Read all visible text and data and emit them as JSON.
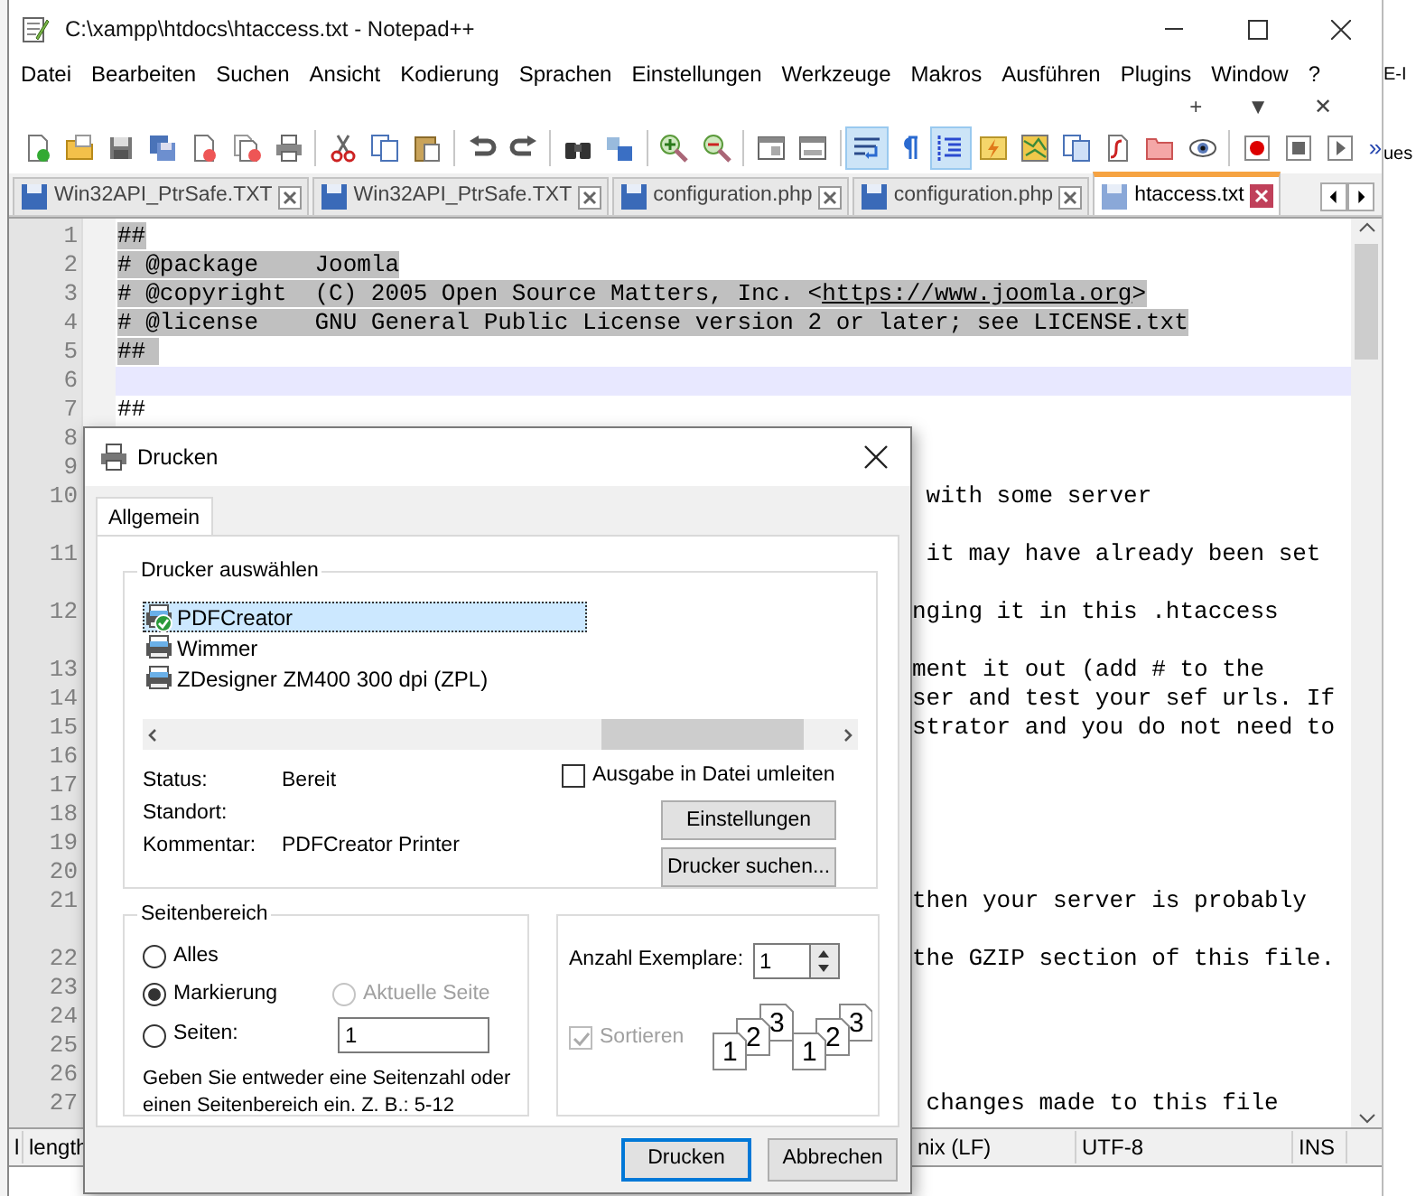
{
  "window": {
    "title": "C:\\xampp\\htdocs\\htaccess.txt - Notepad++"
  },
  "menu": [
    "Datei",
    "Bearbeiten",
    "Suchen",
    "Ansicht",
    "Kodierung",
    "Sprachen",
    "Einstellungen",
    "Werkzeuge",
    "Makros",
    "Ausführen",
    "Plugins",
    "Window",
    "?"
  ],
  "mdi_controls": [
    "+",
    "▼",
    "✕"
  ],
  "toolbar": [
    {
      "kind": "button",
      "pressed": false
    },
    {
      "kind": "button",
      "pressed": false
    },
    {
      "kind": "button",
      "pressed": false
    },
    {
      "kind": "button",
      "pressed": false
    },
    {
      "kind": "button",
      "pressed": false
    },
    {
      "kind": "button",
      "pressed": false
    },
    {
      "kind": "button",
      "pressed": false
    },
    {
      "kind": "separator"
    },
    {
      "kind": "button",
      "pressed": false
    },
    {
      "kind": "button",
      "pressed": false
    },
    {
      "kind": "button",
      "pressed": false
    },
    {
      "kind": "separator"
    },
    {
      "kind": "button",
      "pressed": false
    },
    {
      "kind": "button",
      "pressed": false
    },
    {
      "kind": "separator"
    },
    {
      "kind": "button",
      "pressed": false
    },
    {
      "kind": "button",
      "pressed": false
    },
    {
      "kind": "separator"
    },
    {
      "kind": "button",
      "pressed": false
    },
    {
      "kind": "button",
      "pressed": false
    },
    {
      "kind": "separator"
    },
    {
      "kind": "button",
      "pressed": false
    },
    {
      "kind": "button",
      "pressed": false
    },
    {
      "kind": "separator"
    },
    {
      "kind": "button",
      "pressed": true
    },
    {
      "kind": "button",
      "pressed": false
    },
    {
      "kind": "button",
      "pressed": true
    },
    {
      "kind": "button",
      "pressed": false
    },
    {
      "kind": "button",
      "pressed": false
    },
    {
      "kind": "button",
      "pressed": false
    },
    {
      "kind": "button",
      "pressed": false
    },
    {
      "kind": "button",
      "pressed": false
    },
    {
      "kind": "button",
      "pressed": false
    },
    {
      "kind": "separator"
    },
    {
      "kind": "button",
      "pressed": false
    },
    {
      "kind": "button",
      "pressed": false
    },
    {
      "kind": "button",
      "pressed": false
    }
  ],
  "toolbar_overflow": "»",
  "tabs": [
    {
      "label": "Win32API_PtrSafe.TXT",
      "selected": false
    },
    {
      "label": "Win32API_PtrSafe.TXT",
      "selected": false
    },
    {
      "label": "configuration.php",
      "selected": false
    },
    {
      "label": "configuration.php",
      "selected": false
    },
    {
      "label": "htaccess.txt",
      "selected": true
    }
  ],
  "editor": {
    "lines": [
      {
        "kind": "line",
        "number": "1",
        "selected": true,
        "segments": [
          {
            "kind": "code",
            "text": "##"
          }
        ]
      },
      {
        "kind": "line",
        "number": "2",
        "selected": true,
        "segments": [
          {
            "kind": "code",
            "text": "# @package    Joomla"
          }
        ]
      },
      {
        "kind": "line",
        "number": "3",
        "selected": true,
        "segments": [
          {
            "kind": "code",
            "text": "# @copyright  (C) 2005 Open Source Matters, Inc. <"
          },
          {
            "kind": "link",
            "text": "https://www.joomla.org"
          },
          {
            "kind": "code",
            "text": ">"
          }
        ]
      },
      {
        "kind": "line",
        "number": "4",
        "selected": true,
        "segments": [
          {
            "kind": "code",
            "text": "# @license    GNU General Public License version 2 or later; see LICENSE.txt"
          }
        ]
      },
      {
        "kind": "line",
        "number": "5",
        "selected": true,
        "segments": [
          {
            "kind": "code",
            "text": "## "
          }
        ]
      },
      {
        "kind": "line",
        "number": "6",
        "current": true
      },
      {
        "kind": "line",
        "number": "7",
        "segments": [
          {
            "kind": "code",
            "text": "##"
          }
        ]
      },
      {
        "kind": "line",
        "number": "8"
      },
      {
        "kind": "line",
        "number": "9"
      },
      {
        "kind": "line",
        "number": "10",
        "clipped": true,
        "segments": [
          {
            "kind": "code",
            "text": " with some server"
          }
        ]
      },
      {
        "kind": "wrap"
      },
      {
        "kind": "line",
        "number": "11",
        "clipped": true,
        "segments": [
          {
            "kind": "code",
            "text": " it may have already been set"
          }
        ]
      },
      {
        "kind": "wrap"
      },
      {
        "kind": "line",
        "number": "12",
        "clipped": true,
        "segments": [
          {
            "kind": "code",
            "text": "nging it in this .htaccess"
          }
        ]
      },
      {
        "kind": "wrap"
      },
      {
        "kind": "line",
        "number": "13",
        "clipped": true,
        "segments": [
          {
            "kind": "code",
            "text": "ment it out (add # to the"
          }
        ]
      },
      {
        "kind": "line",
        "number": "14",
        "clipped": true,
        "segments": [
          {
            "kind": "code",
            "text": "ser and test your sef urls. If"
          }
        ]
      },
      {
        "kind": "line",
        "number": "15",
        "clipped": true,
        "segments": [
          {
            "kind": "code",
            "text": "strator and you do not need to"
          }
        ]
      },
      {
        "kind": "line",
        "number": "16"
      },
      {
        "kind": "line",
        "number": "17"
      },
      {
        "kind": "line",
        "number": "18"
      },
      {
        "kind": "line",
        "number": "19"
      },
      {
        "kind": "line",
        "number": "20"
      },
      {
        "kind": "line",
        "number": "21",
        "clipped": true,
        "segments": [
          {
            "kind": "code",
            "text": "then your server is probably"
          }
        ]
      },
      {
        "kind": "wrap"
      },
      {
        "kind": "line",
        "number": "22",
        "clipped": true,
        "segments": [
          {
            "kind": "code",
            "text": "the GZIP section of this file."
          }
        ]
      },
      {
        "kind": "line",
        "number": "23"
      },
      {
        "kind": "line",
        "number": "24"
      },
      {
        "kind": "line",
        "number": "25"
      },
      {
        "kind": "line",
        "number": "26"
      },
      {
        "kind": "line",
        "number": "27",
        "clipped": true,
        "segments": [
          {
            "kind": "code",
            "text": " changes made to this file"
          }
        ]
      }
    ]
  },
  "status_bar": [
    "l",
    "length",
    "nix (LF)",
    "UTF-8",
    "INS"
  ],
  "background_texts": [
    "E-I",
    "ues"
  ],
  "print_dialog": {
    "title": "Drucken",
    "tabs": [
      {
        "label": "Allgemein",
        "selected": true
      }
    ],
    "printer_group": {
      "legend": "Drucker auswählen",
      "printers": [
        {
          "name": "PDFCreator",
          "selected": true,
          "default": true
        },
        {
          "name": "Wimmer",
          "selected": false,
          "default": false
        },
        {
          "name": "ZDesigner ZM400 300 dpi (ZPL)",
          "selected": false,
          "default": false
        }
      ],
      "info": [
        {
          "label": "Status:",
          "value": "Bereit"
        },
        {
          "label": "Standort:"
        },
        {
          "label": "Kommentar:",
          "value": "PDFCreator Printer"
        }
      ],
      "print_to_file": {
        "label": "Ausgabe in Datei umleiten",
        "checked": false
      },
      "buttons": [
        "Einstellungen",
        "Drucker suchen..."
      ]
    },
    "page_range": {
      "legend": "Seitenbereich",
      "options": [
        {
          "label": "Alles",
          "selected": false,
          "disabled": false
        },
        {
          "label": "Markierung",
          "selected": true,
          "disabled": false
        },
        {
          "label": "Aktuelle Seite",
          "selected": false,
          "disabled": true
        },
        {
          "label": "Seiten:",
          "selected": false,
          "disabled": false
        }
      ],
      "pages_value": "1",
      "hint": "Geben Sie entweder eine Seitenzahl oder einen Seitenbereich ein. Z. B.: 5-12"
    },
    "copies": {
      "label": "Anzahl Exemplare:",
      "value": "1",
      "collate": {
        "label": "Sortieren",
        "checked": true,
        "disabled": true
      },
      "collate_pages": [
        "1",
        "2",
        "3",
        "1",
        "2",
        "3"
      ]
    },
    "footer_buttons": [
      {
        "label": "Drucken",
        "default": true
      },
      {
        "label": "Abbrechen",
        "default": false
      }
    ]
  }
}
